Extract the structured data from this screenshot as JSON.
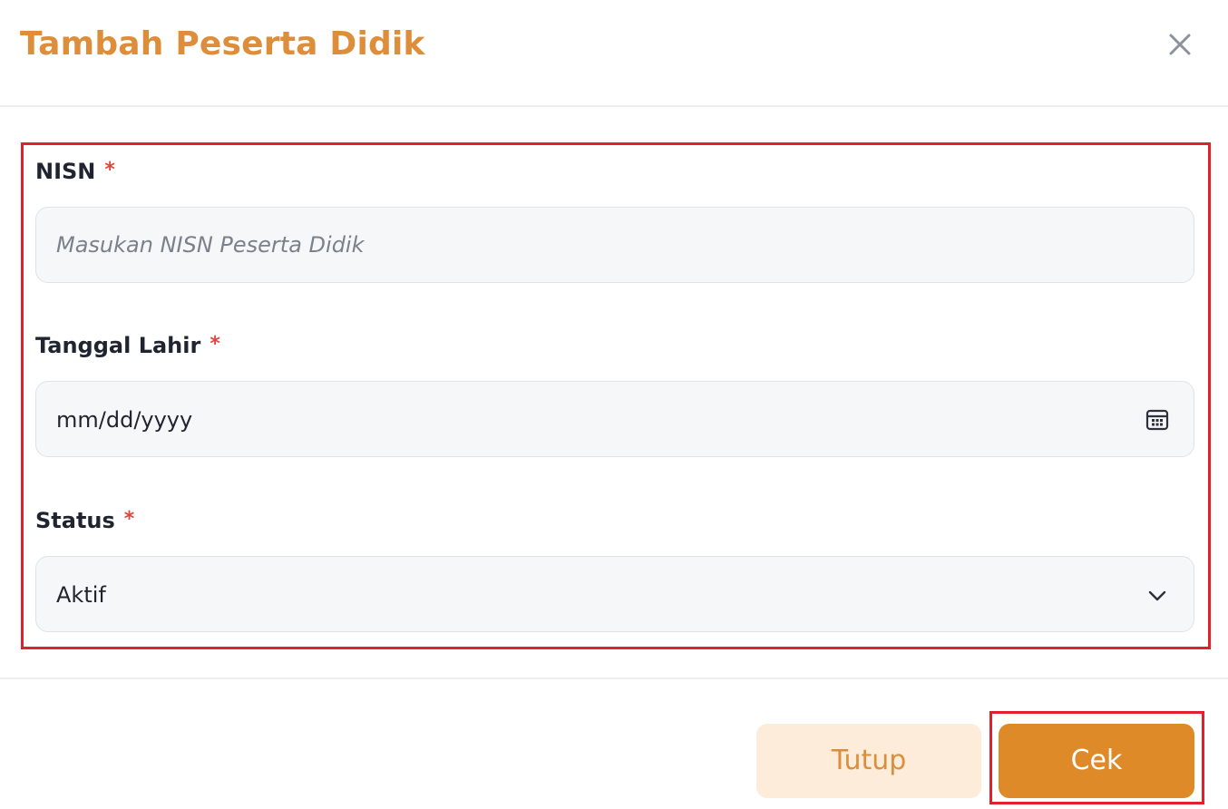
{
  "dialog": {
    "title": "Tambah Peserta Didik",
    "close_icon": "close-icon"
  },
  "form": {
    "nisn": {
      "label": "NISN",
      "required_mark": "*",
      "value": "",
      "placeholder": "Masukan NISN Peserta Didik"
    },
    "birth_date": {
      "label": "Tanggal Lahir",
      "required_mark": "*",
      "display": "mm/dd/yyyy",
      "icon": "calendar-icon"
    },
    "status": {
      "label": "Status",
      "required_mark": "*",
      "selected": "Aktif",
      "icon": "chevron-down-icon"
    }
  },
  "footer": {
    "close_label": "Tutup",
    "check_label": "Cek"
  },
  "colors": {
    "title": "#de8e3a",
    "primary_button": "#df8a29",
    "secondary_button_bg": "#fdecd9",
    "secondary_button_text": "#d8903f",
    "required_mark": "#e0463d",
    "highlight_border": "#e0202d"
  }
}
